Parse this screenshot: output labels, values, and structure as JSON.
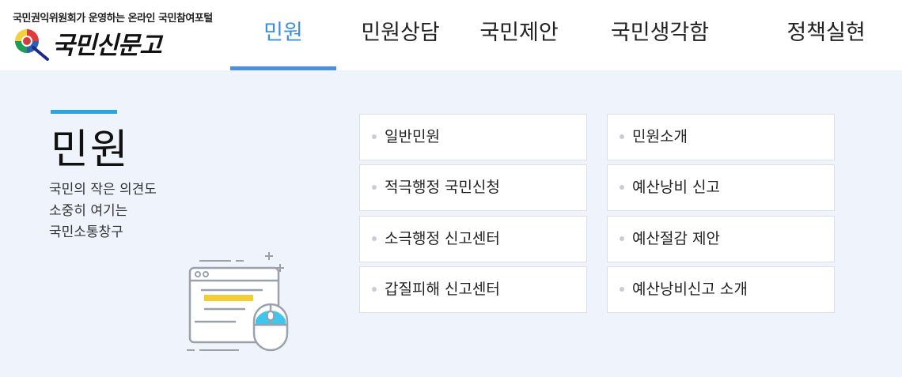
{
  "header": {
    "logo": {
      "tagline": "국민권익위원회가 운영하는 온라인 국민참여포털",
      "name": "국민신문고",
      "icon": "emblem-magnifier-icon"
    },
    "nav": [
      {
        "label": "민원",
        "active": true
      },
      {
        "label": "민원상담",
        "active": false
      },
      {
        "label": "국민제안",
        "active": false
      },
      {
        "label": "국민생각함",
        "active": false
      },
      {
        "label": "정책실현",
        "active": false
      }
    ]
  },
  "panel": {
    "title": "민원",
    "description": [
      "국민의 작은 의견도",
      "소중히 여기는",
      "국민소통창구"
    ],
    "illustration_icon": "browser-window-mouse-icon",
    "left_column": [
      "일반민원",
      "적극행정 국민신청",
      "소극행정 신고센터",
      "갑질피해 신고센터"
    ],
    "right_column": [
      "민원소개",
      "예산낭비 신고",
      "예산절감 제안",
      "예산낭비신고 소개"
    ]
  },
  "colors": {
    "accent": "#4a90e2",
    "title_bar": "#2aa7e0",
    "panel_bg": "#eff3fb",
    "card_border": "#dcdfe6"
  }
}
